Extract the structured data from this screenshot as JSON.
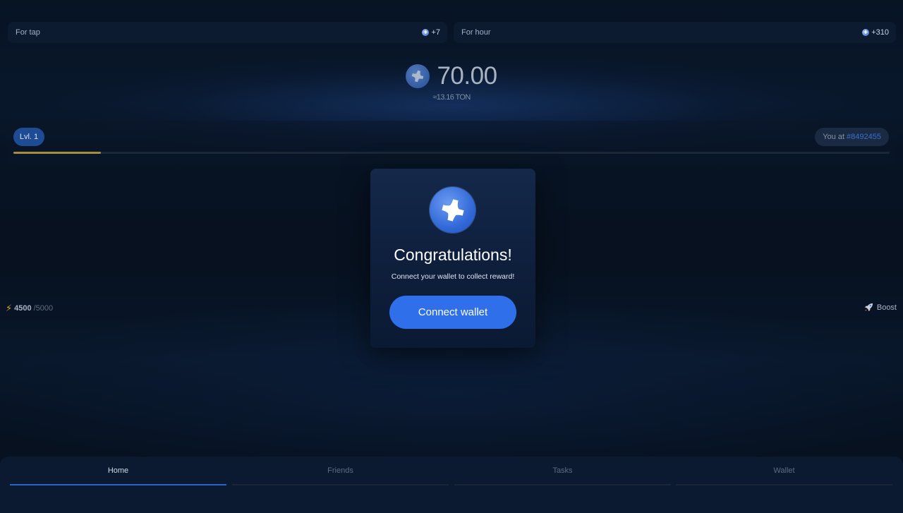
{
  "stats": {
    "for_tap_label": "For tap",
    "for_tap_value": "+7",
    "for_hour_label": "For hour",
    "for_hour_value": "+310"
  },
  "balance": {
    "value": "70.00",
    "ton_equivalent": "≈13.16 TON"
  },
  "level": {
    "label": "Lvl. 1",
    "progress": 0.1,
    "rank_prefix": "You at",
    "rank_value": "#8492455"
  },
  "energy": {
    "current": "4500",
    "max": "/5000"
  },
  "boost": {
    "label": "Boost"
  },
  "modal": {
    "title": "Congratulations!",
    "subtitle": "Connect your wallet to collect reward!",
    "button_label": "Connect wallet"
  },
  "tabs": [
    {
      "label": "Home",
      "active": true
    },
    {
      "label": "Friends",
      "active": false
    },
    {
      "label": "Tasks",
      "active": false
    },
    {
      "label": "Wallet",
      "active": false
    }
  ],
  "colors": {
    "accent": "#2f6fea",
    "progress": "#c9a640",
    "rank": "#3a6fcf"
  },
  "icons": {
    "coin": "cross-coin-icon",
    "energy": "lightning-bolt-icon",
    "boost": "rocket-icon"
  }
}
